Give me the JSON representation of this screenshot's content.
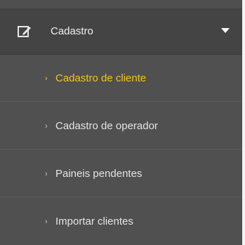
{
  "menu": {
    "header": {
      "icon": "edit-icon",
      "label": "Cadastro",
      "toggle_icon": "caret-down-icon",
      "expanded": true
    },
    "items": [
      {
        "label": "Cadastro de cliente",
        "chevron": "›",
        "active": true
      },
      {
        "label": "Cadastro de operador",
        "chevron": "›",
        "active": false
      },
      {
        "label": "Paineis pendentes",
        "chevron": "›",
        "active": false
      },
      {
        "label": "Importar clientes",
        "chevron": "›",
        "active": false
      }
    ]
  },
  "colors": {
    "active_text": "#f5c518",
    "header_bg": "#444444",
    "submenu_bg": "#505050",
    "text": "#e4e4e4"
  }
}
